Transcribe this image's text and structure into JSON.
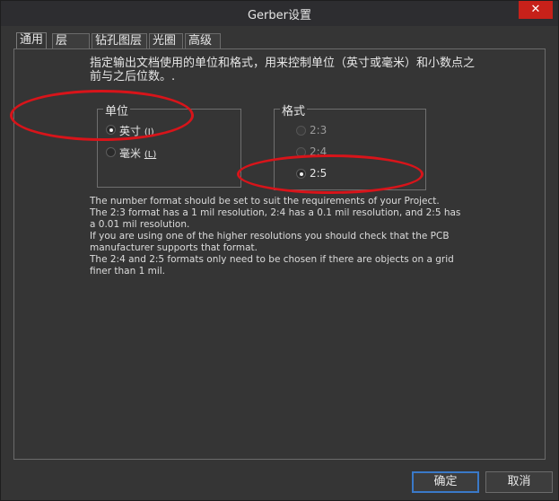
{
  "window": {
    "title": "Gerber设置",
    "close_glyph": "✕"
  },
  "tabs": [
    {
      "label": "通用",
      "active": true
    },
    {
      "label": "层",
      "active": false
    },
    {
      "label": "钻孔图层",
      "active": false
    },
    {
      "label": "光圈",
      "active": false
    },
    {
      "label": "高级",
      "active": false
    }
  ],
  "intro": "指定输出文档使用的单位和格式，用来控制单位（英寸或毫米）和小数点之前与之后位数。.",
  "units": {
    "title": "单位",
    "options": [
      {
        "label": "英寸",
        "accel": "(I)",
        "checked": true
      },
      {
        "label": "毫米",
        "accel": "(L)",
        "checked": false
      }
    ]
  },
  "format": {
    "title": "格式",
    "options": [
      {
        "label": "2:3",
        "checked": false
      },
      {
        "label": "2:4",
        "checked": false
      },
      {
        "label": "2:5",
        "checked": true
      }
    ]
  },
  "info": [
    "The number format should be set to suit the requirements of your Project.",
    "The 2:3 format has a 1 mil resolution, 2:4 has a 0.1 mil resolution, and 2:5 has a 0.01 mil resolution.",
    "If you are using one of the higher resolutions you should check that the PCB manufacturer supports that format.",
    "The 2:4 and 2:5 formats only need to be chosen if there are objects on a grid finer than 1 mil."
  ],
  "buttons": {
    "ok": "确定",
    "cancel": "取消"
  },
  "colors": {
    "annotation": "#d8141a",
    "background": "#353535",
    "close": "#c7211a"
  },
  "icons": {
    "close": "close-icon",
    "radio": "radio-icon"
  }
}
